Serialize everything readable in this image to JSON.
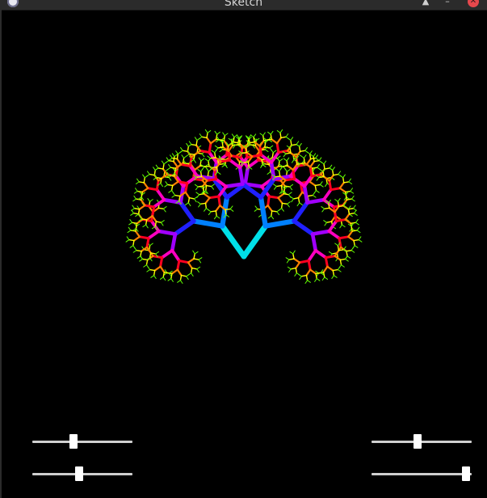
{
  "window": {
    "title": "Sketch",
    "icons": {
      "app": "app-icon",
      "keep_above": "keep-above-icon",
      "minimize": "minimize-icon",
      "close": "close-icon"
    }
  },
  "sketch": {
    "description_icon": "fractal-tree",
    "colors": {
      "trunk": "#00e0e8",
      "level1": "#0080ff",
      "level2": "#2020ff",
      "level3": "#a000ff",
      "level4": "#ff00c0",
      "level5": "#ff0020",
      "level6": "#ff8000",
      "level7": "#ffff00",
      "level8": "#60ff00"
    }
  },
  "sliders": {
    "left_top": {
      "value": 0.41
    },
    "left_bottom": {
      "value": 0.47
    },
    "right_top": {
      "value": 0.46
    },
    "right_bottom": {
      "value": 0.94
    }
  }
}
